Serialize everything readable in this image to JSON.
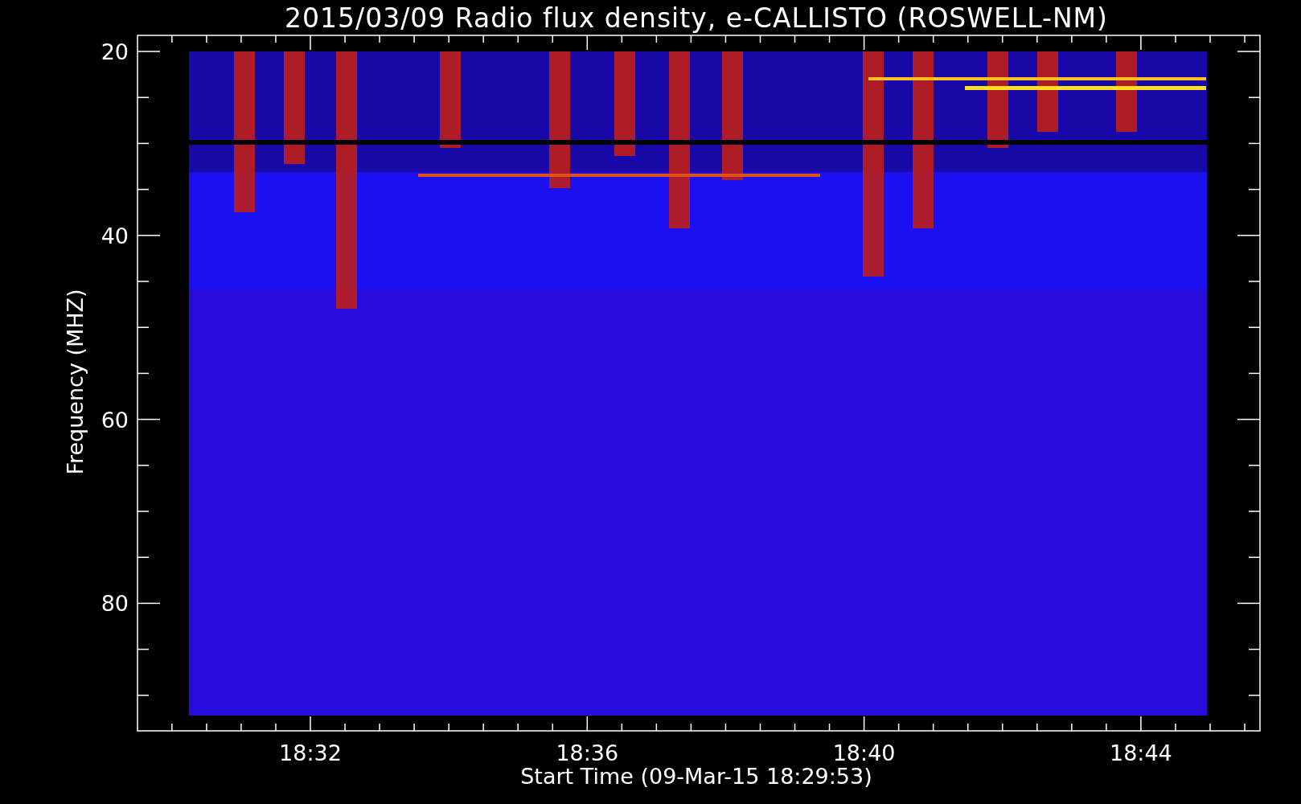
{
  "title": "2015/03/09  Radio flux density, e-CALLISTO (ROSWELL-NM)",
  "xlabel": "Start Time (09-Mar-15 18:29:53)",
  "ylabel": "Frequency (MHZ)",
  "xticks": [
    "18:32",
    "18:36",
    "18:40",
    "18:44"
  ],
  "yticks": [
    "20",
    "40",
    "60",
    "80"
  ]
}
